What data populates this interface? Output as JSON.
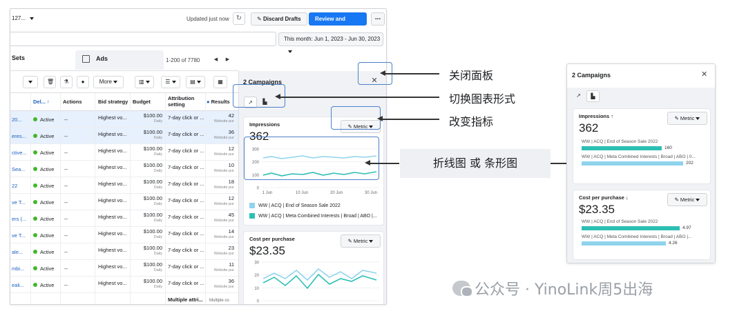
{
  "topbar": {
    "account": "127...",
    "updated": "Updated just now",
    "discard": "Discard Drafts",
    "publish": "Review and Publish",
    "more": "..."
  },
  "date_range": "This month: Jun 1, 2023 - Jun 30, 2023",
  "tabs": {
    "sets": "Sets",
    "ads": "Ads",
    "pager": "1-200 of 7780"
  },
  "toolbar": {
    "more": "More"
  },
  "columns": {
    "del": "Del... ↑",
    "actions": "Actions",
    "bid": "Bid strategy",
    "budget": "Budget",
    "attribution": "Attribution setting",
    "results": "Results"
  },
  "rows": [
    {
      "name": "20...",
      "del": "Active",
      "act": "--",
      "bid": "Highest vo...",
      "budget": "$100.00",
      "period": "Daily",
      "attr": "7-day click or ...",
      "res": "42",
      "res_sub": "Website pur",
      "hl": true
    },
    {
      "name": "eres...",
      "del": "Active",
      "act": "--",
      "bid": "Highest vo...",
      "budget": "$100.00",
      "period": "Daily",
      "attr": "7-day click or ...",
      "res": "36",
      "res_sub": "Website pur",
      "hl": true
    },
    {
      "name": "ctive...",
      "del": "Active",
      "act": "--",
      "bid": "Highest vo...",
      "budget": "$100.00",
      "period": "Daily",
      "attr": "7-day click or ...",
      "res": "12",
      "res_sub": "Website pur",
      "hl": false
    },
    {
      "name": "Sea...",
      "del": "Active",
      "act": "--",
      "bid": "Highest vo...",
      "budget": "$100.00",
      "period": "Daily",
      "attr": "7-day click or ...",
      "res": "10",
      "res_sub": "Website pur",
      "hl": false
    },
    {
      "name": "22",
      "del": "Active",
      "act": "--",
      "bid": "Highest vo...",
      "budget": "$100.00",
      "period": "Daily",
      "attr": "7-day click or ...",
      "res": "18",
      "res_sub": "Website pur",
      "hl": false
    },
    {
      "name": "ve T...",
      "del": "Active",
      "act": "--",
      "bid": "Highest vo...",
      "budget": "$100.00",
      "period": "Daily",
      "attr": "7-day click or ...",
      "res": "12",
      "res_sub": "Website pur",
      "hl": false
    },
    {
      "name": "ers (...",
      "del": "Active",
      "act": "--",
      "bid": "Highest vo...",
      "budget": "$100.00",
      "period": "Daily",
      "attr": "7-day click or ...",
      "res": "45",
      "res_sub": "Website pur",
      "hl": false
    },
    {
      "name": "ve T...",
      "del": "Active",
      "act": "--",
      "bid": "Highest vo...",
      "budget": "$100.00",
      "period": "Daily",
      "attr": "7-day click or ...",
      "res": "14",
      "res_sub": "Website pur",
      "hl": false
    },
    {
      "name": "ale...",
      "del": "Active",
      "act": "--",
      "bid": "Highest vo...",
      "budget": "$100.00",
      "period": "Daily",
      "attr": "7-day click or ...",
      "res": "23",
      "res_sub": "Website pur",
      "hl": false
    },
    {
      "name": "mbi...",
      "del": "Active",
      "act": "--",
      "bid": "Highest vo...",
      "budget": "$100.00",
      "period": "Daily",
      "attr": "7-day click or ...",
      "res": "11",
      "res_sub": "Website pur",
      "hl": false
    },
    {
      "name": "eali...",
      "del": "Active",
      "act": "--",
      "bid": "Highest vo...",
      "budget": "$100.00",
      "period": "Daily",
      "attr": "7-day click or ...",
      "res": "36",
      "res_sub": "Website pur",
      "hl": false
    }
  ],
  "footer_row": {
    "attr": "Multiple attri...",
    "res": "Multiple co"
  },
  "panel": {
    "title": "2 Campaigns",
    "metric": "Metric",
    "impressions_label": "Impressions",
    "impressions_value": "362",
    "cpp_label": "Cost per purchase",
    "cpp_value": "$23.35",
    "series": [
      "WW | ACQ | End of Season Sale 2022",
      "WW | ACQ | Meta Combined Interests | Broad | ABO |..."
    ],
    "colors": [
      "#8fd3ec",
      "#2dbfb4"
    ],
    "x_ticks": [
      "1 Jun",
      "10 Jun",
      "20 Jun",
      "30 Jun"
    ],
    "imp_y_ticks": [
      "300",
      "200",
      "100",
      "0"
    ],
    "cpp_y_ticks": [
      "30",
      "20",
      "10",
      "0"
    ]
  },
  "annotations": {
    "close": "关闭面板",
    "toggle": "切换图表形式",
    "metric": "改变指标",
    "chart": "折线图 或 条形图"
  },
  "bar_panel": {
    "title": "2 Campaigns",
    "impressions_label": "Impressions ↑",
    "impressions_value": "362",
    "cpp_label": "Cost per purchase ↓",
    "cpp_value": "$23.35",
    "metric": "Metric",
    "imp_bars": [
      {
        "label": "WW | ACQ | End of Season Sale 2022",
        "value": 160,
        "display": "160"
      },
      {
        "label": "WW | ACQ | Meta Combined Interests | Broad | ABO | 0...",
        "value": 202,
        "display": "202"
      }
    ],
    "cpp_bars": [
      {
        "label": "WW | ACQ | End of Season Sale 2022",
        "value": 4.97,
        "display": "4.97"
      },
      {
        "label": "WW | ACQ | Meta Combined Interests | Broad | ABO |...",
        "value": 4.26,
        "display": "4.26"
      }
    ]
  },
  "watermark": "公众号 · YinoLink周5出海"
}
